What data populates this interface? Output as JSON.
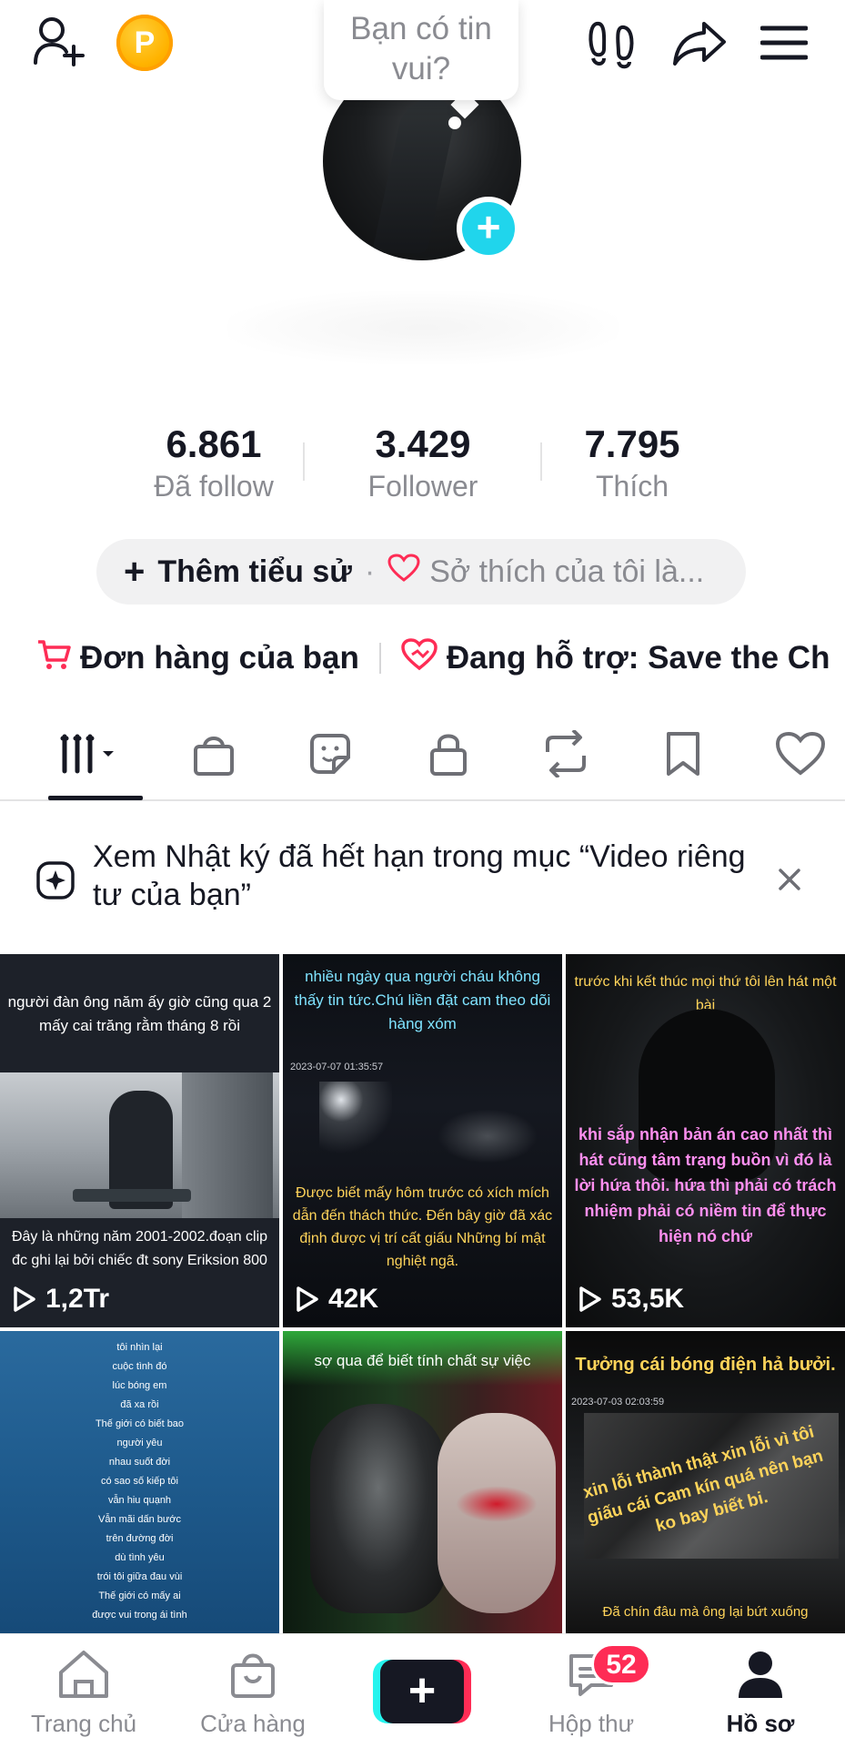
{
  "topbar": {
    "icons": [
      "add-friend-icon",
      "coin-icon",
      "footprints-icon",
      "share-icon",
      "menu-icon"
    ],
    "coin_label": "P"
  },
  "status_bubble": {
    "line1": "Bạn có tin",
    "line2": "vui?"
  },
  "stats": [
    {
      "value": "6.861",
      "label": "Đã follow"
    },
    {
      "value": "3.429",
      "label": "Follower"
    },
    {
      "value": "7.795",
      "label": "Thích"
    }
  ],
  "bio": {
    "add_label": "Thêm tiểu sử",
    "separator": "·",
    "hint": "Sở thích của tôi là..."
  },
  "links": {
    "orders": "Đơn hàng của bạn",
    "support": "Đang hỗ trợ: Save the Ch"
  },
  "tabs": [
    "videos-grid-icon",
    "shop-bag-icon",
    "sticker-icon",
    "lock-icon",
    "repost-icon",
    "bookmark-icon",
    "heart-icon"
  ],
  "banner": {
    "text": "Xem Nhật ký đã hết hạn trong mục “Video riêng tư của bạn”"
  },
  "videos": [
    {
      "caption_top": "người đàn ông năm ấy giờ cũng qua 2 mấy cai trăng rằm tháng 8 rồi",
      "caption_bottom": "Đây là những năm 2001-2002.đoạn clip đc ghi lại bởi chiếc đt sony Eriksion 800",
      "views": "1,2Tr"
    },
    {
      "caption_top": "nhiều ngày qua người cháu không thấy tin tức.Chú liền đặt cam theo dõi hàng xóm",
      "timestamp": "2023-07-07 01:35:57",
      "caption_bottom": "Được biết mấy hôm trước có xích mích dẫn đến thách thức. Đến bây giờ đã xác định được vị trí cất giấu Những bí mật nghiệt ngã.",
      "views": "42K"
    },
    {
      "caption_top": "trước khi kết thúc mọi thứ tôi lên hát một bài",
      "caption_bottom": "khi sắp nhận bản án cao nhất thì hát cũng tâm trạng buồn vì đó là lời hứa thôi. hứa thì phải có trách nhiệm phải có niềm tin để thực hiện nó chứ",
      "views": "53,5K"
    },
    {
      "lines": [
        "tôi nhìn lại",
        "cuộc tình đó",
        "lúc bóng em",
        "đã xa rồi",
        "Thế giới có biết bao",
        "người yêu",
        "nhau suốt đời",
        "có sao số kiếp tôi",
        "vẫn hiu quạnh",
        "Vẫn mãi dấn bước",
        "trên đường đời",
        "dù tình yêu",
        "trói tôi giữa đau vùi",
        "Thế giới có mấy ai",
        "được vui trong ái tình"
      ]
    },
    {
      "caption_top": "sợ qua để biết tính chất sự việc"
    },
    {
      "caption_top": "Tưởng cái bóng điện hả bưởi.",
      "timestamp": "2023-07-03 02:03:59",
      "caption_mid": "xin lỗi thành thật xin lỗi vì tôi giấu cái Cam kín quá nên bạn ko bay biết bi.",
      "caption_bottom": "Đã chín đâu mà ông lại bứt xuống"
    }
  ],
  "bottom_nav": [
    {
      "label": "Trang chủ",
      "icon": "home-icon"
    },
    {
      "label": "Cửa hàng",
      "icon": "shop-icon"
    },
    {
      "label": "",
      "icon": "create-plus-icon"
    },
    {
      "label": "Hộp thư",
      "icon": "inbox-icon"
    },
    {
      "label": "Hồ sơ",
      "icon": "profile-icon"
    }
  ],
  "inbox_badge": "52",
  "colors": {
    "accent_cyan": "#20d5ec",
    "accent_red": "#fe2c55",
    "text": "#161823",
    "muted": "#8a8b91"
  }
}
